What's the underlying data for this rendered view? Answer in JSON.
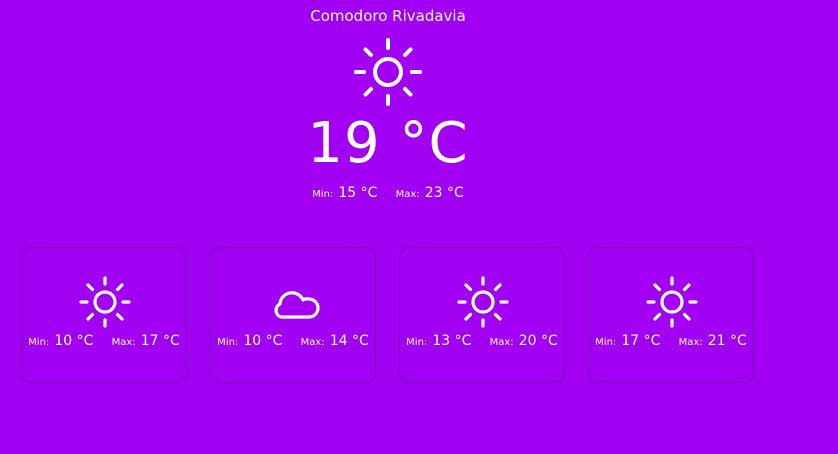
{
  "current": {
    "city": "Comodoro Rivadavia",
    "icon": "sun-icon",
    "temperature": "19 °C",
    "min_label": "Min:",
    "min_value": "15 °C",
    "max_label": "Max:",
    "max_value": "23 °C"
  },
  "forecast": [
    {
      "icon": "sun-icon",
      "min_label": "Min:",
      "min_value": "10 °C",
      "max_label": "Max:",
      "max_value": "17 °C"
    },
    {
      "icon": "cloud-icon",
      "min_label": "Min:",
      "min_value": "10 °C",
      "max_label": "Max:",
      "max_value": "14 °C"
    },
    {
      "icon": "sun-icon",
      "min_label": "Min:",
      "min_value": "13 °C",
      "max_label": "Max:",
      "max_value": "20 °C"
    },
    {
      "icon": "sun-icon",
      "min_label": "Min:",
      "min_value": "17 °C",
      "max_label": "Max:",
      "max_value": "21 °C"
    }
  ],
  "colors": {
    "background": "#a100f2",
    "text": "#ffffff",
    "card_border": "#5a0090"
  }
}
